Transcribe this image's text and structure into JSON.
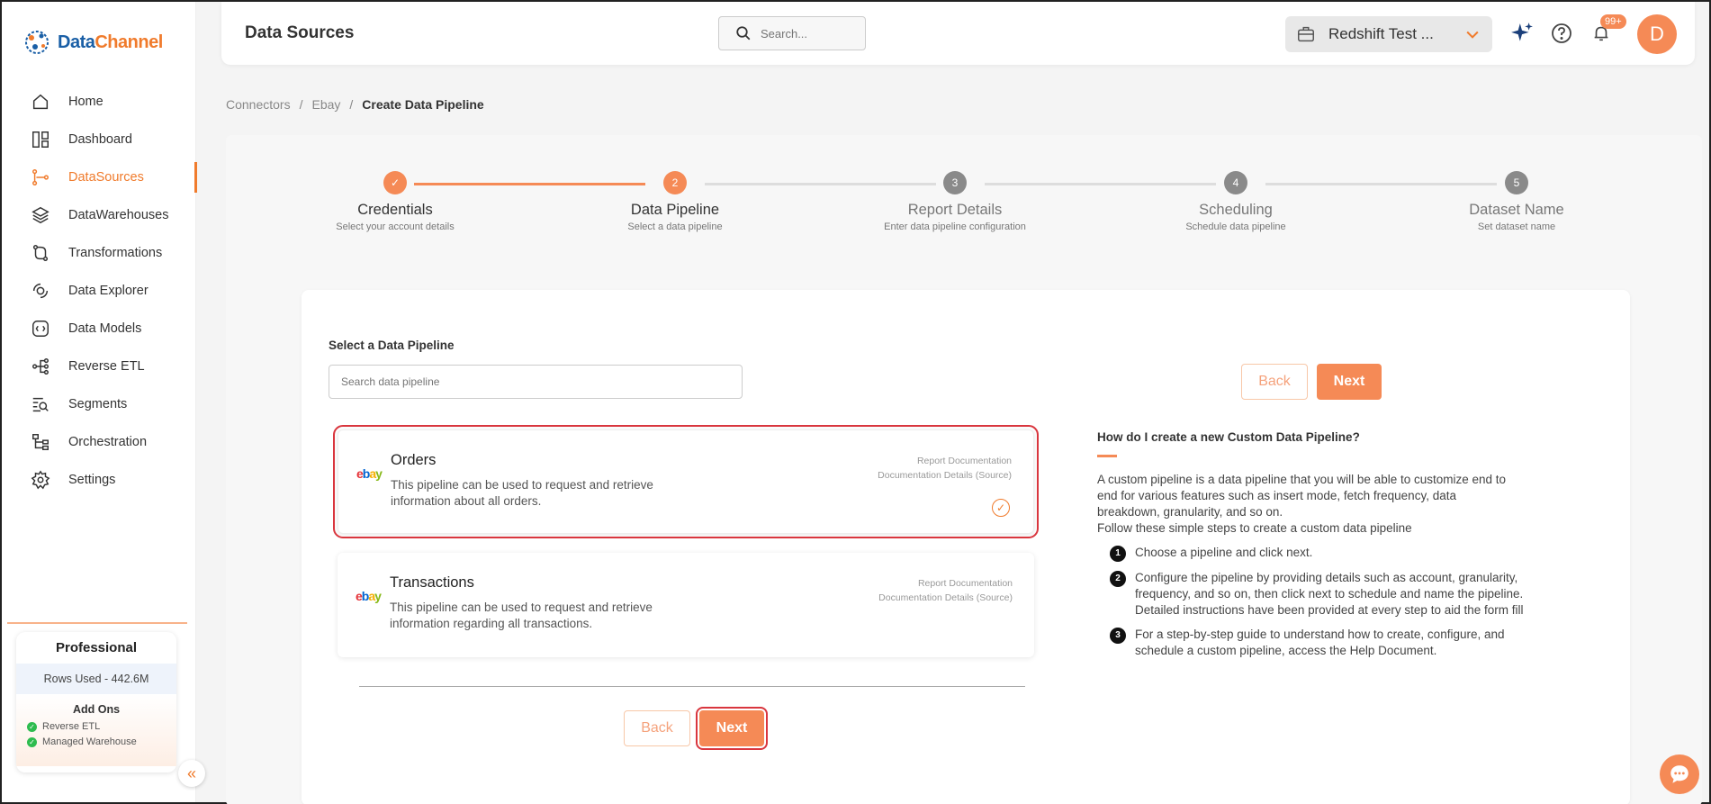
{
  "brand": {
    "name_part1": "Data",
    "name_part2": "Channel"
  },
  "nav": {
    "items": [
      {
        "label": "Home",
        "icon": "home-icon"
      },
      {
        "label": "Dashboard",
        "icon": "dashboard-icon"
      },
      {
        "label": "DataSources",
        "icon": "datasources-icon",
        "active": true
      },
      {
        "label": "DataWarehouses",
        "icon": "datawarehouses-icon"
      },
      {
        "label": "Transformations",
        "icon": "transformations-icon"
      },
      {
        "label": "Data Explorer",
        "icon": "data-explorer-icon"
      },
      {
        "label": "Data Models",
        "icon": "data-models-icon"
      },
      {
        "label": "Reverse ETL",
        "icon": "reverse-etl-icon"
      },
      {
        "label": "Segments",
        "icon": "segments-icon"
      },
      {
        "label": "Orchestration",
        "icon": "orchestration-icon"
      },
      {
        "label": "Settings",
        "icon": "gear-icon"
      }
    ]
  },
  "plan": {
    "title": "Professional",
    "rows_used": "Rows Used - 442.6M",
    "addons_title": "Add Ons",
    "addons": [
      "Reverse ETL",
      "Managed Warehouse"
    ]
  },
  "header": {
    "title": "Data Sources",
    "search_placeholder": "Search...",
    "workspace": "Redshift Test ...",
    "notification_count": "99+",
    "avatar_initial": "D"
  },
  "breadcrumb": [
    "Connectors",
    "Ebay",
    "Create Data Pipeline"
  ],
  "steps": [
    {
      "num": "✓",
      "title": "Credentials",
      "sub": "Select your account details",
      "state": "done"
    },
    {
      "num": "2",
      "title": "Data Pipeline",
      "sub": "Select a data pipeline",
      "state": "active"
    },
    {
      "num": "3",
      "title": "Report Details",
      "sub": "Enter data pipeline configuration",
      "state": "pending"
    },
    {
      "num": "4",
      "title": "Scheduling",
      "sub": "Schedule data pipeline",
      "state": "pending"
    },
    {
      "num": "5",
      "title": "Dataset Name",
      "sub": "Set dataset name",
      "state": "pending"
    }
  ],
  "form": {
    "label": "Select a Data Pipeline",
    "search_placeholder": "Search data pipeline",
    "back_label": "Back",
    "next_label": "Next"
  },
  "pipelines": [
    {
      "name": "Orders",
      "description": "This pipeline can be used to request and retrieve information about all orders.",
      "link1": "Report Documentation",
      "link2": "Documentation Details (Source)",
      "selected": true
    },
    {
      "name": "Transactions",
      "description": "This pipeline can be used to request and retrieve information regarding all transactions.",
      "link1": "Report Documentation",
      "link2": "Documentation Details (Source)",
      "selected": false
    }
  ],
  "help": {
    "title": "How do I create a new Custom Data Pipeline?",
    "intro": "A custom pipeline is a data pipeline that you will be able to customize end to end for various features such as insert mode, fetch frequency, data breakdown, granularity, and so on.",
    "follow": "Follow these simple steps to create a custom data pipeline",
    "steps": [
      "Choose a pipeline and click next.",
      "Configure the pipeline by providing details such as account, granularity, frequency, and so on, then click next to schedule and name the pipeline. Detailed instructions have been provided at every step to aid the form fill",
      "For a step-by-step guide to understand how to create, configure, and schedule a custom pipeline, access the Help Document."
    ]
  },
  "colors": {
    "accent": "#f58a56",
    "active_nav": "#f07b2c",
    "selection_outline": "#d9363e"
  }
}
